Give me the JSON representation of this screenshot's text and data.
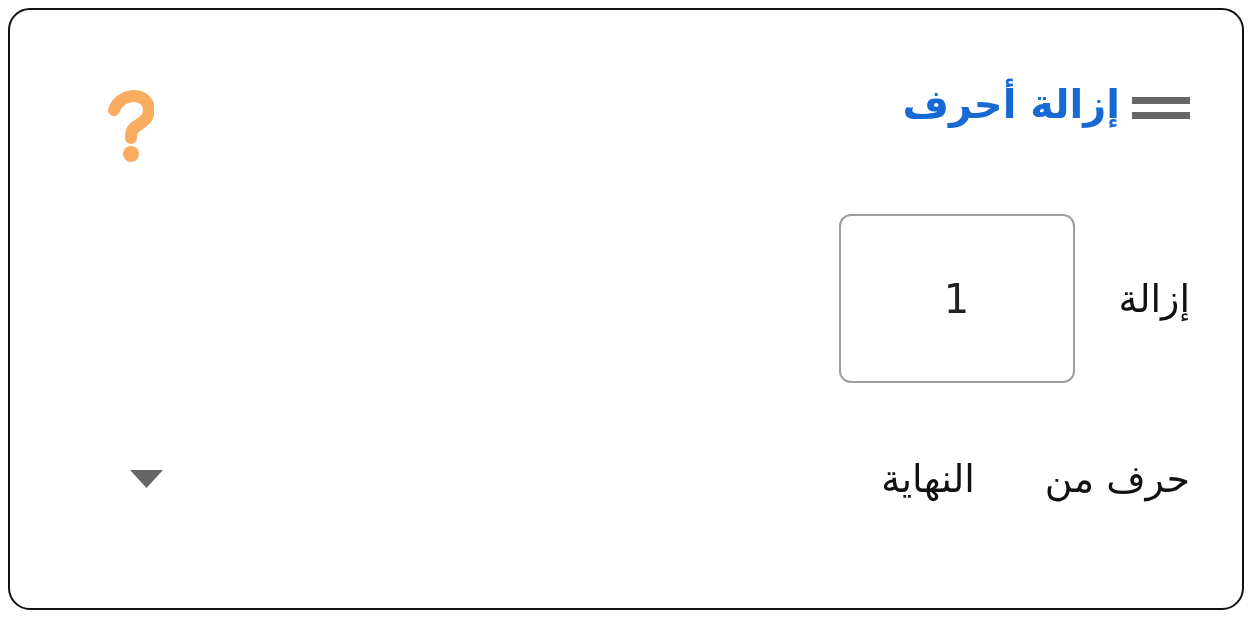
{
  "block": {
    "title": "إزالة أحرف",
    "rows": [
      {
        "kind": "number",
        "label": "إزالة",
        "value": "1"
      },
      {
        "kind": "dropdown",
        "label": "حرف من",
        "value": "النهاية"
      }
    ]
  }
}
